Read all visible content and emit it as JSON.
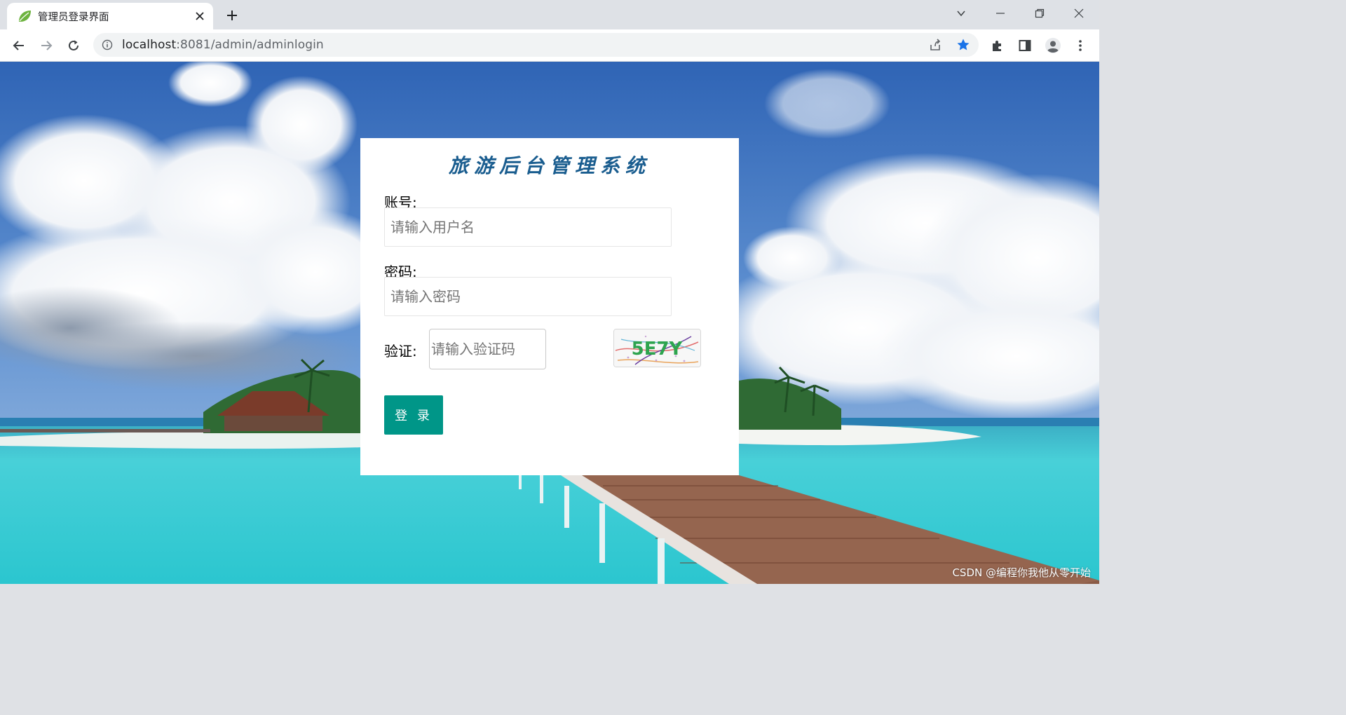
{
  "browser": {
    "tab": {
      "title": "管理员登录界面",
      "favicon": "spring-leaf-icon"
    },
    "toolbar": {
      "url_host": "localhost",
      "url_rest": ":8081/admin/adminlogin",
      "bookmarked": true
    },
    "icons": [
      "tab-close-icon",
      "new-tab-icon",
      "tab-search-icon",
      "minimize-icon",
      "restore-icon",
      "window-close-icon",
      "back-icon",
      "forward-icon",
      "reload-icon",
      "site-info-icon",
      "share-icon",
      "bookmark-star-icon",
      "extensions-icon",
      "side-panel-icon",
      "profile-icon",
      "menu-icon"
    ]
  },
  "login": {
    "title": "旅游后台管理系统",
    "account_label": "账号:",
    "account_placeholder": "请输入用户名",
    "password_label": "密码:",
    "password_placeholder": "请输入密码",
    "captcha_label": "验证:",
    "captcha_placeholder": "请输入验证码",
    "captcha_text": "5E7Y",
    "submit_label": "登 录"
  },
  "watermark": "CSDN @编程你我他从零开始",
  "colors": {
    "primary_button": "#009688",
    "title": "#1a5d8f",
    "star": "#1a73e8"
  }
}
